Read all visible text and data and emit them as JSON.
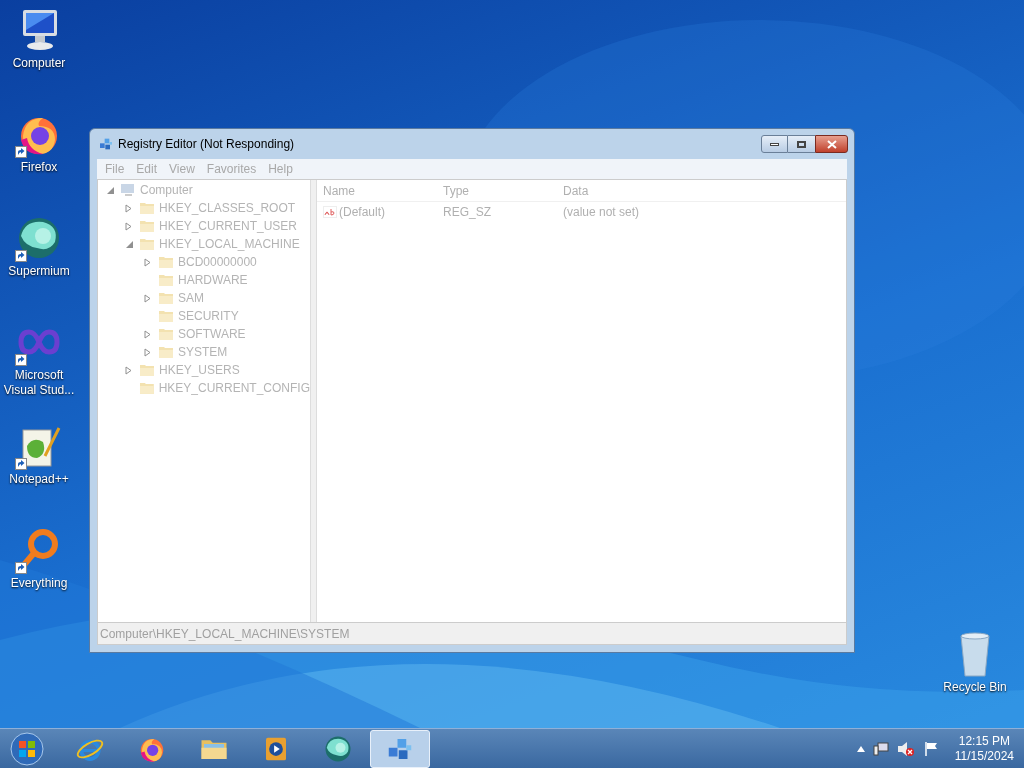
{
  "desktop_icons": [
    {
      "kind": "computer",
      "label": "Computer",
      "shortcut": false
    },
    {
      "kind": "firefox",
      "label": "Firefox",
      "shortcut": true
    },
    {
      "kind": "supermium",
      "label": "Supermium",
      "shortcut": true
    },
    {
      "kind": "vs",
      "label": "Microsoft Visual Stud...",
      "shortcut": true
    },
    {
      "kind": "notepad",
      "label": "Notepad++",
      "shortcut": true
    },
    {
      "kind": "everything",
      "label": "Everything",
      "shortcut": true
    }
  ],
  "recycle_bin": {
    "label": "Recycle Bin"
  },
  "window": {
    "title": "Registry Editor (Not Responding)",
    "menu": [
      "File",
      "Edit",
      "View",
      "Favorites",
      "Help"
    ],
    "tree": [
      {
        "label": "Computer",
        "kind": "computer",
        "expandable": true,
        "expanded": true,
        "children": [
          {
            "label": "HKEY_CLASSES_ROOT",
            "expandable": true,
            "expanded": false
          },
          {
            "label": "HKEY_CURRENT_USER",
            "expandable": true,
            "expanded": false
          },
          {
            "label": "HKEY_LOCAL_MACHINE",
            "expandable": true,
            "expanded": true,
            "children": [
              {
                "label": "BCD00000000",
                "expandable": true,
                "expanded": false
              },
              {
                "label": "HARDWARE",
                "expandable": false
              },
              {
                "label": "SAM",
                "expandable": true,
                "expanded": false
              },
              {
                "label": "SECURITY",
                "expandable": false
              },
              {
                "label": "SOFTWARE",
                "expandable": true,
                "expanded": false
              },
              {
                "label": "SYSTEM",
                "expandable": true,
                "expanded": false
              }
            ]
          },
          {
            "label": "HKEY_USERS",
            "expandable": true,
            "expanded": false
          },
          {
            "label": "HKEY_CURRENT_CONFIG",
            "expandable": false
          }
        ]
      }
    ],
    "columns": [
      "Name",
      "Type",
      "Data"
    ],
    "values": [
      {
        "name": "(Default)",
        "type": "REG_SZ",
        "data": "(value not set)"
      }
    ],
    "status_bar": "Computer\\HKEY_LOCAL_MACHINE\\SYSTEM"
  },
  "taskbar": {
    "apps": [
      {
        "kind": "ie",
        "active": false
      },
      {
        "kind": "firefox",
        "active": false
      },
      {
        "kind": "explorer",
        "active": false
      },
      {
        "kind": "media",
        "active": false
      },
      {
        "kind": "supermium",
        "active": false
      },
      {
        "kind": "regedit",
        "active": true
      }
    ],
    "clock": {
      "time": "12:15 PM",
      "date": "11/15/2024"
    }
  }
}
